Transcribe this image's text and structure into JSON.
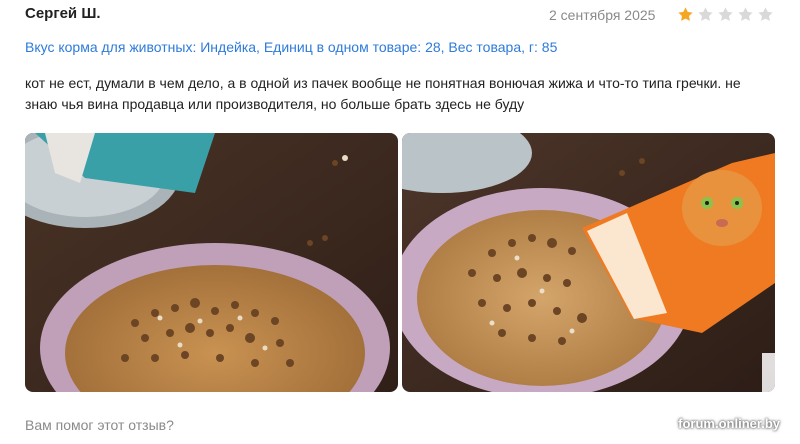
{
  "review": {
    "author": "Сергей Ш.",
    "date": "2 сентября 2025",
    "rating": 1,
    "max_rating": 5,
    "attributes": "Вкус корма для животных: Индейка, Единиц в одном товаре: 28, Вес товара, г: 85",
    "text": "кот не ест, думали в чем дело, а в одной из пачек вообще не понятная вонючая жижа и что-то типа гречки. не знаю чья вина продавца или производителя, но больше брать здесь не буду"
  },
  "colors": {
    "star_filled": "#f5a623",
    "star_empty": "#d9d9d9",
    "link": "#2e7bd9"
  },
  "photos": [
    {
      "icon": "photo-bowl-buckwheat"
    },
    {
      "icon": "photo-bowl-with-pouch"
    }
  ],
  "footer": {
    "helpful_question": "Вам помог этот отзыв?",
    "watermark": "forum.onliner.by"
  }
}
